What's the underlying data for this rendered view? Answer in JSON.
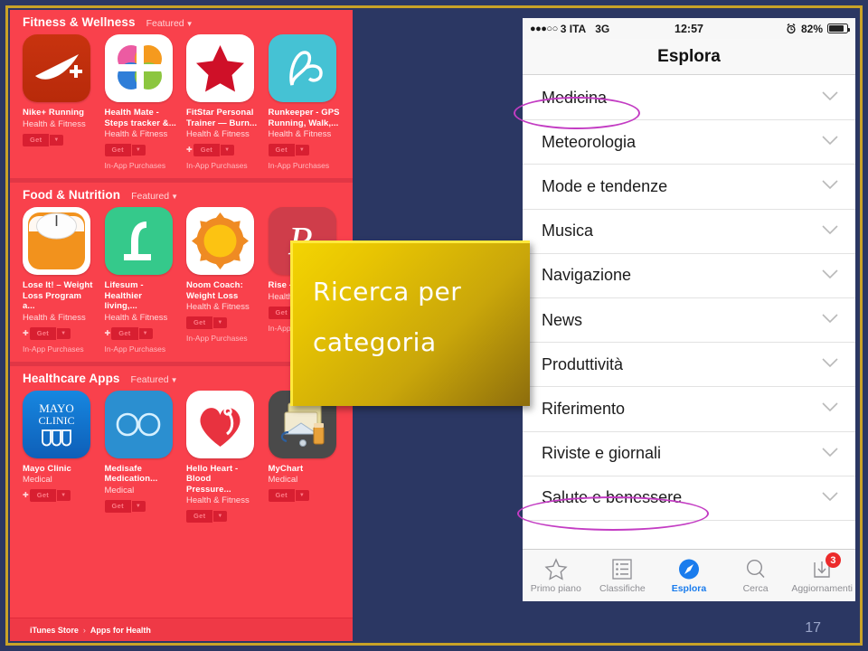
{
  "slide": {
    "number": "17",
    "frame_color": "#c9a227",
    "background_color": "#2b3763"
  },
  "callout": {
    "text": "Ricerca per categoria",
    "fill_color": "#e8c502",
    "text_color": "#ffffff"
  },
  "annotations": {
    "ellipse_color": "#c33cc3",
    "highlighted": [
      "Medicina",
      "Salute e benessere"
    ]
  },
  "appstore": {
    "background_color": "#f9414c",
    "breadcrumb": {
      "root": "iTunes Store",
      "separator": "›",
      "current": "Apps for Health"
    },
    "sections": [
      {
        "title": "Fitness & Wellness",
        "featured_label": "Featured",
        "apps": [
          {
            "name": "Nike+ Running",
            "category": "Health & Fitness",
            "get_label": "Get",
            "in_app": "",
            "plus": false,
            "icon": "nike-plus-icon"
          },
          {
            "name": "Health Mate - Steps tracker &...",
            "category": "Health & Fitness",
            "get_label": "Get",
            "in_app": "In-App Purchases",
            "plus": false,
            "icon": "health-mate-icon"
          },
          {
            "name": "FitStar Personal Trainer — Burn...",
            "category": "Health & Fitness",
            "get_label": "Get",
            "in_app": "In-App Purchases",
            "plus": true,
            "icon": "fitstar-icon"
          },
          {
            "name": "Runkeeper - GPS Running, Walk,...",
            "category": "Health & Fitness",
            "get_label": "Get",
            "in_app": "In-App Purchases",
            "plus": false,
            "icon": "runkeeper-icon"
          }
        ]
      },
      {
        "title": "Food & Nutrition",
        "featured_label": "Featured",
        "apps": [
          {
            "name": "Lose It! – Weight Loss Program a...",
            "category": "Health & Fitness",
            "get_label": "Get",
            "in_app": "In-App Purchases",
            "plus": true,
            "icon": "lose-it-icon"
          },
          {
            "name": "Lifesum - Healthier living,...",
            "category": "Health & Fitness",
            "get_label": "Get",
            "in_app": "In-App Purchases",
            "plus": true,
            "icon": "lifesum-icon"
          },
          {
            "name": "Noom Coach: Weight Loss",
            "category": "Health & Fitness",
            "get_label": "Get",
            "in_app": "In-App Purchases",
            "plus": false,
            "icon": "noom-icon"
          },
          {
            "name": "Rise - Weigh",
            "category": "Health",
            "get_label": "Get",
            "in_app": "In-App",
            "plus": false,
            "icon": "rise-icon"
          }
        ]
      },
      {
        "title": "Healthcare Apps",
        "featured_label": "Featured",
        "apps": [
          {
            "name": "Mayo Clinic",
            "category": "Medical",
            "get_label": "Get",
            "in_app": "",
            "plus": true,
            "icon": "mayo-clinic-icon"
          },
          {
            "name": "Medisafe Medication...",
            "category": "Medical",
            "get_label": "Get",
            "in_app": "",
            "plus": false,
            "icon": "medisafe-icon"
          },
          {
            "name": "Hello Heart - Blood Pressure...",
            "category": "Health & Fitness",
            "get_label": "Get",
            "in_app": "",
            "plus": false,
            "icon": "hello-heart-icon"
          },
          {
            "name": "MyChart",
            "category": "Medical",
            "get_label": "Get",
            "in_app": "",
            "plus": false,
            "icon": "mychart-icon"
          }
        ]
      }
    ]
  },
  "iphone": {
    "status_bar": {
      "signal_dots": "●●●○○",
      "carrier": "3 ITA",
      "network": "3G",
      "time": "12:57",
      "alarm_icon": "alarm-icon",
      "battery_percent": "82%"
    },
    "nav_title": "Esplora",
    "categories": [
      {
        "label": "Medicina"
      },
      {
        "label": "Meteorologia"
      },
      {
        "label": "Mode e tendenze"
      },
      {
        "label": "Musica"
      },
      {
        "label": "Navigazione"
      },
      {
        "label": "News"
      },
      {
        "label": "Produttività"
      },
      {
        "label": "Riferimento"
      },
      {
        "label": "Riviste e giornali"
      },
      {
        "label": "Salute e benessere"
      }
    ],
    "tabs": [
      {
        "label": "Primo piano",
        "icon": "star-icon",
        "active": false,
        "badge": ""
      },
      {
        "label": "Classifiche",
        "icon": "list-icon",
        "active": false,
        "badge": ""
      },
      {
        "label": "Esplora",
        "icon": "compass-icon",
        "active": true,
        "badge": ""
      },
      {
        "label": "Cerca",
        "icon": "search-icon",
        "active": false,
        "badge": ""
      },
      {
        "label": "Aggiornamenti",
        "icon": "download-icon",
        "active": false,
        "badge": "3"
      }
    ],
    "accent_color": "#1a7ced",
    "badge_color": "#ec2b2b"
  }
}
